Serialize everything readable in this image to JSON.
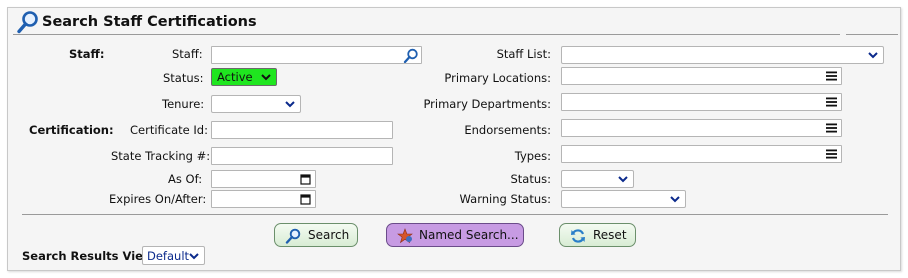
{
  "title": "Search Staff Certifications",
  "staff_section": {
    "label": "Staff:",
    "staff_label": "Staff:",
    "staff_value": "",
    "status_label": "Status:",
    "status_value": "Active",
    "tenure_label": "Tenure:",
    "tenure_value": ""
  },
  "certification_section": {
    "label": "Certification:",
    "certificate_id_label": "Certificate Id:",
    "certificate_id_value": "",
    "state_tracking_label": "State Tracking #:",
    "state_tracking_value": "",
    "as_of_label": "As Of:",
    "as_of_value": "",
    "expires_label": "Expires On/After:",
    "expires_value": ""
  },
  "right_fields": {
    "staff_list_label": "Staff List:",
    "primary_locations_label": "Primary Locations:",
    "primary_departments_label": "Primary Departments:",
    "endorsements_label": "Endorsements:",
    "types_label": "Types:",
    "status_label": "Status:",
    "warning_status_label": "Warning Status:"
  },
  "buttons": {
    "search": "Search",
    "named_search": "Named Search...",
    "reset": "Reset"
  },
  "results_view": {
    "label": "Search Results View:",
    "value": "Default"
  },
  "colors": {
    "status_active": "#1fe61f",
    "named_search_bg": "#c79be3",
    "icon_blue": "#1f5fb0"
  },
  "icons": {
    "title": "magnifier-icon",
    "search_button": "magnifier-icon",
    "named_search_button": "star-icon",
    "reset_button": "refresh-icon"
  }
}
